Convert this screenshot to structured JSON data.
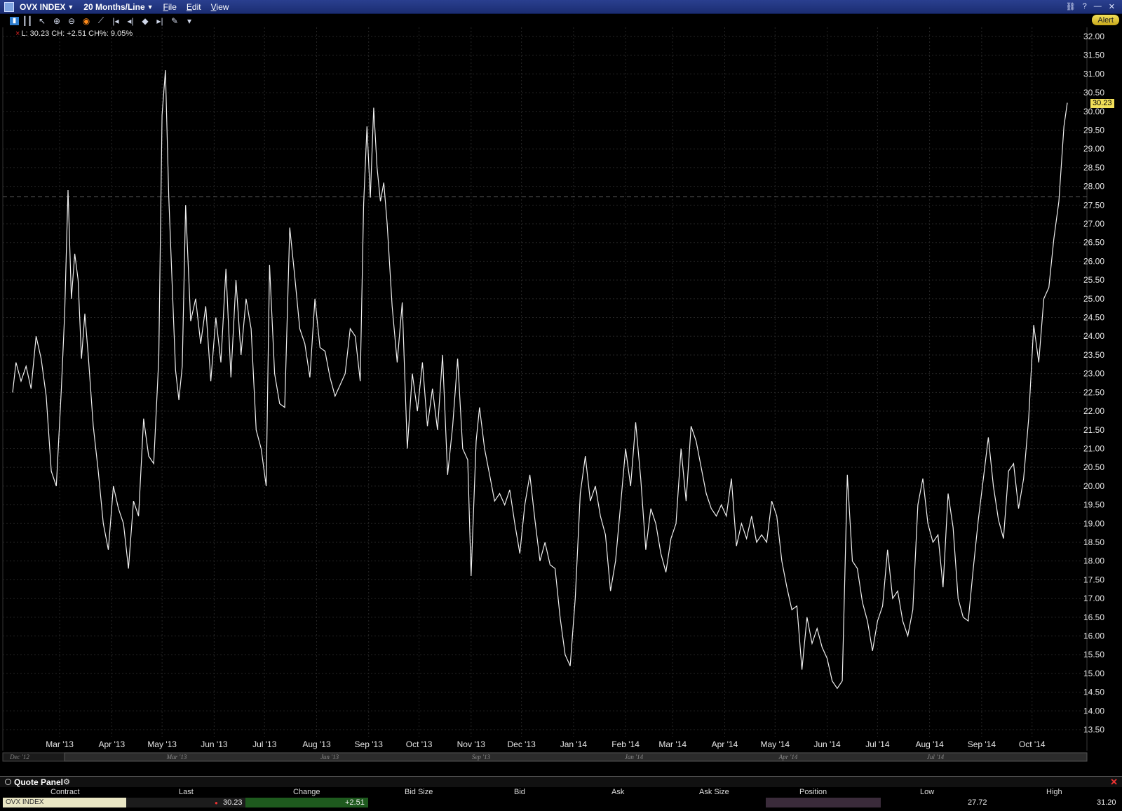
{
  "window": {
    "symbol": "OVX INDEX",
    "timeframe": "20 Months/Line",
    "menus": [
      "File",
      "Edit",
      "View"
    ]
  },
  "toolbar": {
    "alert_label": "Alert"
  },
  "chart_info": {
    "legend_text": "L: 30.23 CH: +2.51 CH%: 9.05%",
    "last_price_marker": "30.23"
  },
  "chart_data": {
    "type": "line",
    "ylim": [
      13.25,
      32.25
    ],
    "y_ticks": [
      "13.50",
      "14.00",
      "14.50",
      "15.00",
      "15.50",
      "16.00",
      "16.50",
      "17.00",
      "17.50",
      "18.00",
      "18.50",
      "19.00",
      "19.50",
      "20.00",
      "20.50",
      "21.00",
      "21.50",
      "22.00",
      "22.50",
      "23.00",
      "23.50",
      "24.00",
      "24.50",
      "25.00",
      "25.50",
      "26.00",
      "26.50",
      "27.00",
      "27.50",
      "28.00",
      "28.50",
      "29.00",
      "29.50",
      "30.00",
      "30.50",
      "31.00",
      "31.50",
      "32.00"
    ],
    "x_ticks": [
      "Mar '13",
      "Apr '13",
      "May '13",
      "Jun '13",
      "Jul '13",
      "Aug '13",
      "Sep '13",
      "Oct '13",
      "Nov '13",
      "Dec '13",
      "Jan '14",
      "Feb '14",
      "Mar '14",
      "Apr '14",
      "May '14",
      "Jun '14",
      "Jul '14",
      "Aug '14",
      "Sep '14",
      "Oct '14"
    ],
    "x_range": [
      "2013-02-01",
      "2014-10-22"
    ],
    "overview_ticks": [
      "Dec '12",
      "Mar '13",
      "Jun '13",
      "Sep '13",
      "Jan '14",
      "Apr '14",
      "Jul '14"
    ],
    "reference_line": 27.72,
    "grid": true,
    "points": [
      [
        "2013-02-01",
        22.5
      ],
      [
        "2013-02-03",
        23.3
      ],
      [
        "2013-02-06",
        22.8
      ],
      [
        "2013-02-09",
        23.2
      ],
      [
        "2013-02-12",
        22.6
      ],
      [
        "2013-02-15",
        24.0
      ],
      [
        "2013-02-18",
        23.4
      ],
      [
        "2013-02-21",
        22.4
      ],
      [
        "2013-02-24",
        20.4
      ],
      [
        "2013-02-27",
        20.0
      ],
      [
        "2013-03-02",
        22.6
      ],
      [
        "2013-03-04",
        24.6
      ],
      [
        "2013-03-06",
        27.9
      ],
      [
        "2013-03-08",
        25.0
      ],
      [
        "2013-03-10",
        26.2
      ],
      [
        "2013-03-12",
        25.5
      ],
      [
        "2013-03-14",
        23.4
      ],
      [
        "2013-03-16",
        24.6
      ],
      [
        "2013-03-18",
        23.5
      ],
      [
        "2013-03-21",
        21.6
      ],
      [
        "2013-03-24",
        20.4
      ],
      [
        "2013-03-27",
        19.0
      ],
      [
        "2013-03-30",
        18.3
      ],
      [
        "2013-04-02",
        20.0
      ],
      [
        "2013-04-05",
        19.4
      ],
      [
        "2013-04-08",
        19.0
      ],
      [
        "2013-04-11",
        17.8
      ],
      [
        "2013-04-14",
        19.6
      ],
      [
        "2013-04-17",
        19.2
      ],
      [
        "2013-04-20",
        21.8
      ],
      [
        "2013-04-23",
        20.8
      ],
      [
        "2013-04-26",
        20.6
      ],
      [
        "2013-04-29",
        23.4
      ],
      [
        "2013-05-01",
        29.9
      ],
      [
        "2013-05-03",
        31.1
      ],
      [
        "2013-05-05",
        27.7
      ],
      [
        "2013-05-07",
        25.4
      ],
      [
        "2013-05-09",
        23.1
      ],
      [
        "2013-05-11",
        22.3
      ],
      [
        "2013-05-13",
        23.2
      ],
      [
        "2013-05-15",
        27.5
      ],
      [
        "2013-05-18",
        24.4
      ],
      [
        "2013-05-21",
        25.0
      ],
      [
        "2013-05-24",
        23.8
      ],
      [
        "2013-05-27",
        24.8
      ],
      [
        "2013-05-30",
        22.8
      ],
      [
        "2013-06-02",
        24.5
      ],
      [
        "2013-06-05",
        23.3
      ],
      [
        "2013-06-08",
        25.8
      ],
      [
        "2013-06-11",
        22.9
      ],
      [
        "2013-06-14",
        25.5
      ],
      [
        "2013-06-17",
        23.5
      ],
      [
        "2013-06-20",
        25.0
      ],
      [
        "2013-06-23",
        24.2
      ],
      [
        "2013-06-26",
        21.5
      ],
      [
        "2013-06-29",
        21.0
      ],
      [
        "2013-07-02",
        20.0
      ],
      [
        "2013-07-04",
        25.9
      ],
      [
        "2013-07-07",
        23.0
      ],
      [
        "2013-07-10",
        22.2
      ],
      [
        "2013-07-13",
        22.1
      ],
      [
        "2013-07-16",
        26.9
      ],
      [
        "2013-07-19",
        25.6
      ],
      [
        "2013-07-22",
        24.2
      ],
      [
        "2013-07-25",
        23.8
      ],
      [
        "2013-07-28",
        22.9
      ],
      [
        "2013-07-31",
        25.0
      ],
      [
        "2013-08-03",
        23.7
      ],
      [
        "2013-08-06",
        23.6
      ],
      [
        "2013-08-09",
        22.9
      ],
      [
        "2013-08-12",
        22.4
      ],
      [
        "2013-08-15",
        22.7
      ],
      [
        "2013-08-18",
        23.0
      ],
      [
        "2013-08-21",
        24.2
      ],
      [
        "2013-08-24",
        24.0
      ],
      [
        "2013-08-27",
        22.8
      ],
      [
        "2013-08-29",
        27.5
      ],
      [
        "2013-08-31",
        29.6
      ],
      [
        "2013-09-02",
        27.7
      ],
      [
        "2013-09-04",
        30.1
      ],
      [
        "2013-09-06",
        28.5
      ],
      [
        "2013-09-08",
        27.6
      ],
      [
        "2013-09-10",
        28.1
      ],
      [
        "2013-09-12",
        27.0
      ],
      [
        "2013-09-15",
        24.8
      ],
      [
        "2013-09-18",
        23.3
      ],
      [
        "2013-09-21",
        24.9
      ],
      [
        "2013-09-24",
        21.0
      ],
      [
        "2013-09-27",
        23.0
      ],
      [
        "2013-09-30",
        22.0
      ],
      [
        "2013-10-03",
        23.3
      ],
      [
        "2013-10-06",
        21.6
      ],
      [
        "2013-10-09",
        22.6
      ],
      [
        "2013-10-12",
        21.5
      ],
      [
        "2013-10-15",
        23.5
      ],
      [
        "2013-10-18",
        20.3
      ],
      [
        "2013-10-21",
        21.6
      ],
      [
        "2013-10-24",
        23.4
      ],
      [
        "2013-10-27",
        21.0
      ],
      [
        "2013-10-30",
        20.7
      ],
      [
        "2013-11-01",
        17.6
      ],
      [
        "2013-11-04",
        21.2
      ],
      [
        "2013-11-06",
        22.1
      ],
      [
        "2013-11-09",
        21.0
      ],
      [
        "2013-11-12",
        20.3
      ],
      [
        "2013-11-15",
        19.6
      ],
      [
        "2013-11-18",
        19.8
      ],
      [
        "2013-11-21",
        19.5
      ],
      [
        "2013-11-24",
        19.9
      ],
      [
        "2013-11-27",
        19.0
      ],
      [
        "2013-11-30",
        18.2
      ],
      [
        "2013-12-03",
        19.5
      ],
      [
        "2013-12-06",
        20.3
      ],
      [
        "2013-12-09",
        19.1
      ],
      [
        "2013-12-12",
        18.0
      ],
      [
        "2013-12-15",
        18.5
      ],
      [
        "2013-12-18",
        17.9
      ],
      [
        "2013-12-21",
        17.8
      ],
      [
        "2013-12-24",
        16.5
      ],
      [
        "2013-12-27",
        15.5
      ],
      [
        "2013-12-30",
        15.2
      ],
      [
        "2014-01-02",
        17.0
      ],
      [
        "2014-01-05",
        19.8
      ],
      [
        "2014-01-08",
        20.8
      ],
      [
        "2014-01-11",
        19.6
      ],
      [
        "2014-01-14",
        20.0
      ],
      [
        "2014-01-17",
        19.2
      ],
      [
        "2014-01-20",
        18.7
      ],
      [
        "2014-01-23",
        17.2
      ],
      [
        "2014-01-26",
        18.0
      ],
      [
        "2014-01-29",
        19.5
      ],
      [
        "2014-02-01",
        21.0
      ],
      [
        "2014-02-04",
        20.0
      ],
      [
        "2014-02-07",
        21.7
      ],
      [
        "2014-02-10",
        20.2
      ],
      [
        "2014-02-13",
        18.3
      ],
      [
        "2014-02-16",
        19.4
      ],
      [
        "2014-02-19",
        19.0
      ],
      [
        "2014-02-22",
        18.2
      ],
      [
        "2014-02-25",
        17.7
      ],
      [
        "2014-02-28",
        18.6
      ],
      [
        "2014-03-03",
        19.0
      ],
      [
        "2014-03-06",
        21.0
      ],
      [
        "2014-03-09",
        19.6
      ],
      [
        "2014-03-12",
        21.6
      ],
      [
        "2014-03-15",
        21.2
      ],
      [
        "2014-03-18",
        20.5
      ],
      [
        "2014-03-21",
        19.8
      ],
      [
        "2014-03-24",
        19.4
      ],
      [
        "2014-03-27",
        19.2
      ],
      [
        "2014-03-30",
        19.5
      ],
      [
        "2014-04-02",
        19.2
      ],
      [
        "2014-04-05",
        20.2
      ],
      [
        "2014-04-08",
        18.4
      ],
      [
        "2014-04-11",
        19.0
      ],
      [
        "2014-04-14",
        18.6
      ],
      [
        "2014-04-17",
        19.2
      ],
      [
        "2014-04-20",
        18.5
      ],
      [
        "2014-04-23",
        18.7
      ],
      [
        "2014-04-26",
        18.5
      ],
      [
        "2014-04-29",
        19.6
      ],
      [
        "2014-05-02",
        19.2
      ],
      [
        "2014-05-05",
        18.0
      ],
      [
        "2014-05-08",
        17.3
      ],
      [
        "2014-05-11",
        16.7
      ],
      [
        "2014-05-14",
        16.8
      ],
      [
        "2014-05-17",
        15.1
      ],
      [
        "2014-05-20",
        16.5
      ],
      [
        "2014-05-23",
        15.8
      ],
      [
        "2014-05-26",
        16.2
      ],
      [
        "2014-05-29",
        15.7
      ],
      [
        "2014-06-01",
        15.4
      ],
      [
        "2014-06-04",
        14.8
      ],
      [
        "2014-06-07",
        14.6
      ],
      [
        "2014-06-10",
        14.8
      ],
      [
        "2014-06-13",
        20.3
      ],
      [
        "2014-06-16",
        18.0
      ],
      [
        "2014-06-19",
        17.8
      ],
      [
        "2014-06-22",
        16.9
      ],
      [
        "2014-06-25",
        16.4
      ],
      [
        "2014-06-28",
        15.6
      ],
      [
        "2014-07-01",
        16.4
      ],
      [
        "2014-07-04",
        16.8
      ],
      [
        "2014-07-07",
        18.3
      ],
      [
        "2014-07-10",
        17.0
      ],
      [
        "2014-07-13",
        17.2
      ],
      [
        "2014-07-16",
        16.4
      ],
      [
        "2014-07-19",
        16.0
      ],
      [
        "2014-07-22",
        16.7
      ],
      [
        "2014-07-25",
        19.5
      ],
      [
        "2014-07-28",
        20.2
      ],
      [
        "2014-07-31",
        19.0
      ],
      [
        "2014-08-03",
        18.5
      ],
      [
        "2014-08-06",
        18.7
      ],
      [
        "2014-08-09",
        17.3
      ],
      [
        "2014-08-12",
        19.8
      ],
      [
        "2014-08-15",
        18.9
      ],
      [
        "2014-08-18",
        17.0
      ],
      [
        "2014-08-21",
        16.5
      ],
      [
        "2014-08-24",
        16.4
      ],
      [
        "2014-08-27",
        17.8
      ],
      [
        "2014-08-30",
        19.1
      ],
      [
        "2014-09-02",
        20.2
      ],
      [
        "2014-09-05",
        21.3
      ],
      [
        "2014-09-08",
        20.0
      ],
      [
        "2014-09-11",
        19.1
      ],
      [
        "2014-09-14",
        18.6
      ],
      [
        "2014-09-17",
        20.4
      ],
      [
        "2014-09-20",
        20.6
      ],
      [
        "2014-09-23",
        19.4
      ],
      [
        "2014-09-26",
        20.2
      ],
      [
        "2014-09-29",
        21.8
      ],
      [
        "2014-10-02",
        24.3
      ],
      [
        "2014-10-05",
        23.3
      ],
      [
        "2014-10-08",
        25.0
      ],
      [
        "2014-10-11",
        25.3
      ],
      [
        "2014-10-14",
        26.6
      ],
      [
        "2014-10-17",
        27.6
      ],
      [
        "2014-10-20",
        29.6
      ],
      [
        "2014-10-22",
        30.23
      ]
    ]
  },
  "quote_panel": {
    "title": "Quote Panel",
    "columns": [
      "Contract",
      "Last",
      "Change",
      "Bid Size",
      "Bid",
      "Ask",
      "Ask Size",
      "Position",
      "Low",
      "High"
    ],
    "row": {
      "contract": "OVX INDEX",
      "last": "30.23",
      "change": "+2.51",
      "low": "27.72",
      "high": "31.20"
    }
  }
}
